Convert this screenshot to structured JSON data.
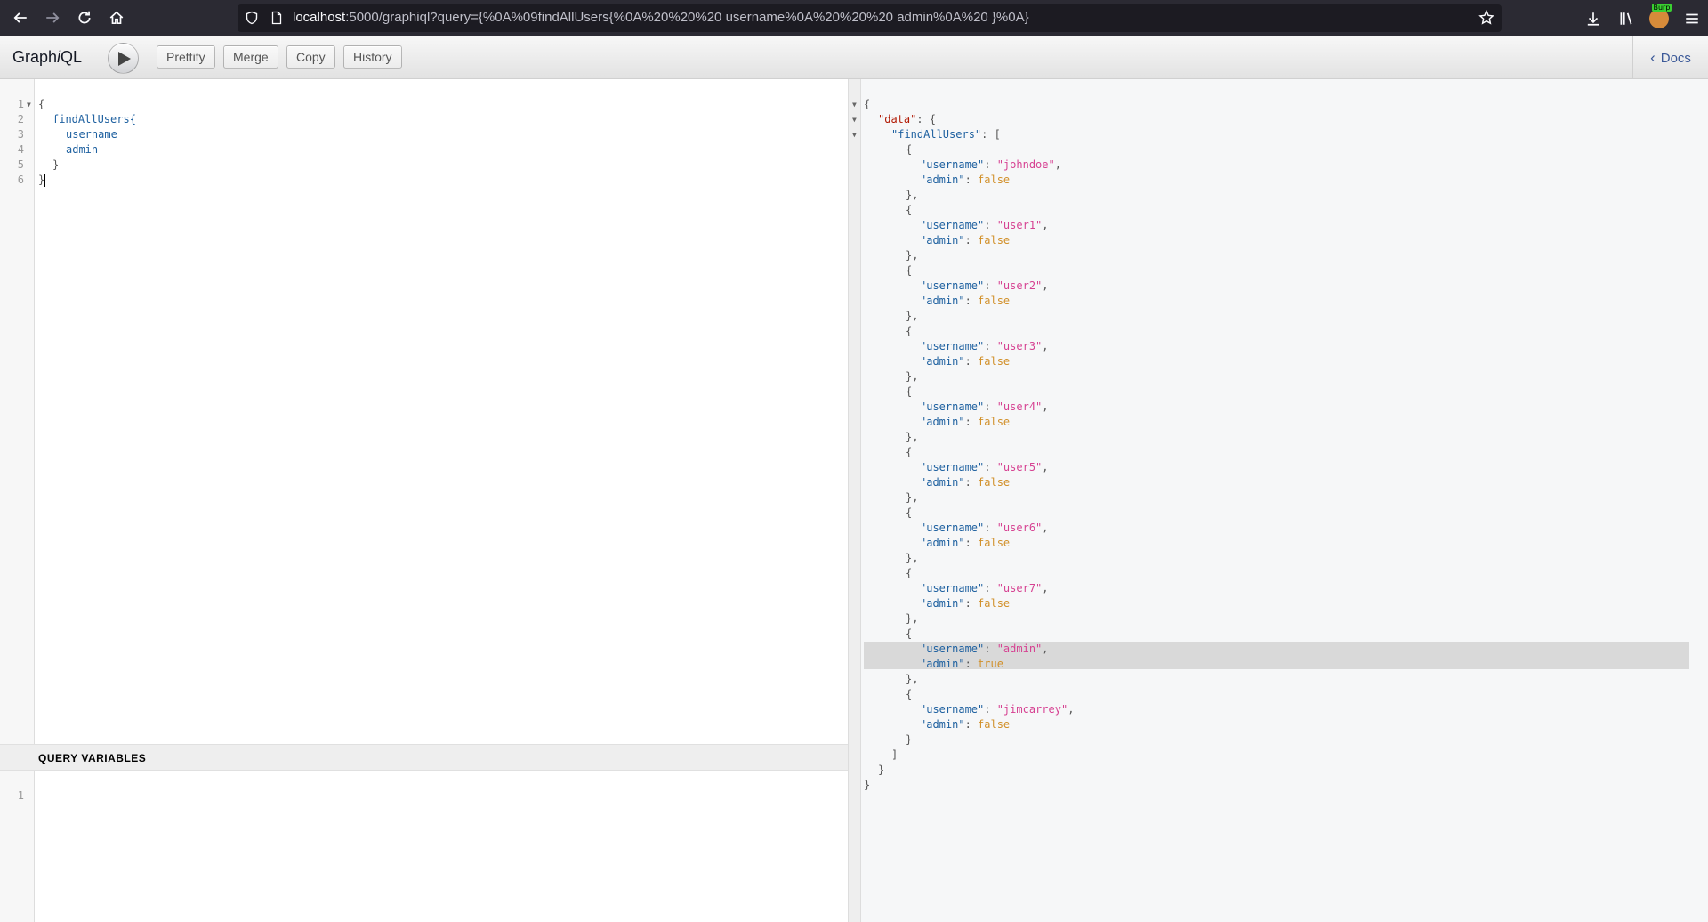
{
  "browser": {
    "url_host": "localhost",
    "url_rest": ":5000/graphiql?query={%0A%09findAllUsers{%0A%20%20%20 username%0A%20%20%20 admin%0A%20 }%0A}",
    "extension_badge": "Burp"
  },
  "toolbar": {
    "title_prefix": "Graph",
    "title_italic": "i",
    "title_suffix": "QL",
    "prettify": "Prettify",
    "merge": "Merge",
    "copy": "Copy",
    "history": "History",
    "docs": "Docs"
  },
  "query_editor": {
    "line_numbers": [
      "1",
      "2",
      "3",
      "4",
      "5",
      "6"
    ],
    "lines": [
      "{",
      "findAllUsers{",
      "username",
      "admin",
      "}",
      "}"
    ]
  },
  "variables": {
    "header": "QUERY VARIABLES",
    "line_numbers": [
      "1"
    ]
  },
  "result": {
    "data_key": "\"data\"",
    "list_key": "\"findAllUsers\"",
    "username_key": "\"username\"",
    "admin_key": "\"admin\"",
    "users": [
      {
        "username": "\"johndoe\"",
        "admin": "false"
      },
      {
        "username": "\"user1\"",
        "admin": "false"
      },
      {
        "username": "\"user2\"",
        "admin": "false"
      },
      {
        "username": "\"user3\"",
        "admin": "false"
      },
      {
        "username": "\"user4\"",
        "admin": "false"
      },
      {
        "username": "\"user5\"",
        "admin": "false"
      },
      {
        "username": "\"user6\"",
        "admin": "false"
      },
      {
        "username": "\"user7\"",
        "admin": "false"
      },
      {
        "username": "\"admin\"",
        "admin": "true"
      },
      {
        "username": "\"jimcarrey\"",
        "admin": "false"
      }
    ]
  }
}
